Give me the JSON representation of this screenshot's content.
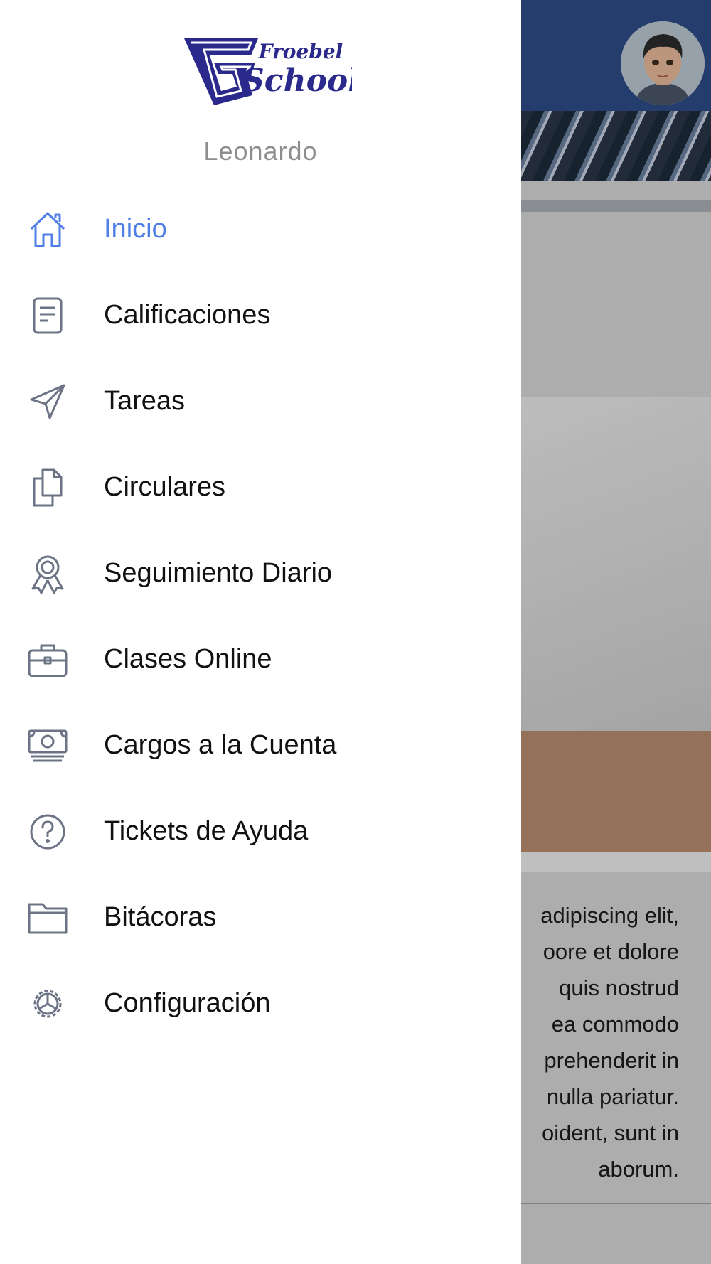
{
  "background": {
    "paragraph_lines": [
      "adipiscing elit,",
      "oore et dolore",
      "quis nostrud",
      "ea commodo",
      "prehenderit in",
      "nulla pariatur.",
      "oident, sunt in",
      "aborum."
    ]
  },
  "drawer": {
    "logo": {
      "line1": "Froebel",
      "line2": "School",
      "letter": "F"
    },
    "user_name": "Leonardo",
    "menu": [
      {
        "label": "Inicio",
        "icon": "home-icon",
        "active": true
      },
      {
        "label": "Calificaciones",
        "icon": "document-icon",
        "active": false
      },
      {
        "label": "Tareas",
        "icon": "paper-plane-icon",
        "active": false
      },
      {
        "label": "Circulares",
        "icon": "files-icon",
        "active": false
      },
      {
        "label": "Seguimiento Diario",
        "icon": "award-icon",
        "active": false
      },
      {
        "label": "Clases Online",
        "icon": "briefcase-icon",
        "active": false
      },
      {
        "label": "Cargos a la Cuenta",
        "icon": "money-icon",
        "active": false
      },
      {
        "label": "Tickets de Ayuda",
        "icon": "help-circle-icon",
        "active": false
      },
      {
        "label": "Bitácoras",
        "icon": "folder-icon",
        "active": false
      },
      {
        "label": "Configuración",
        "icon": "settings-icon",
        "active": false
      }
    ]
  },
  "colors": {
    "accent": "#4f7fe6",
    "header": "#2c4b84",
    "icon_grey": "#6b7385",
    "logo_blue": "#2b2a8c"
  }
}
